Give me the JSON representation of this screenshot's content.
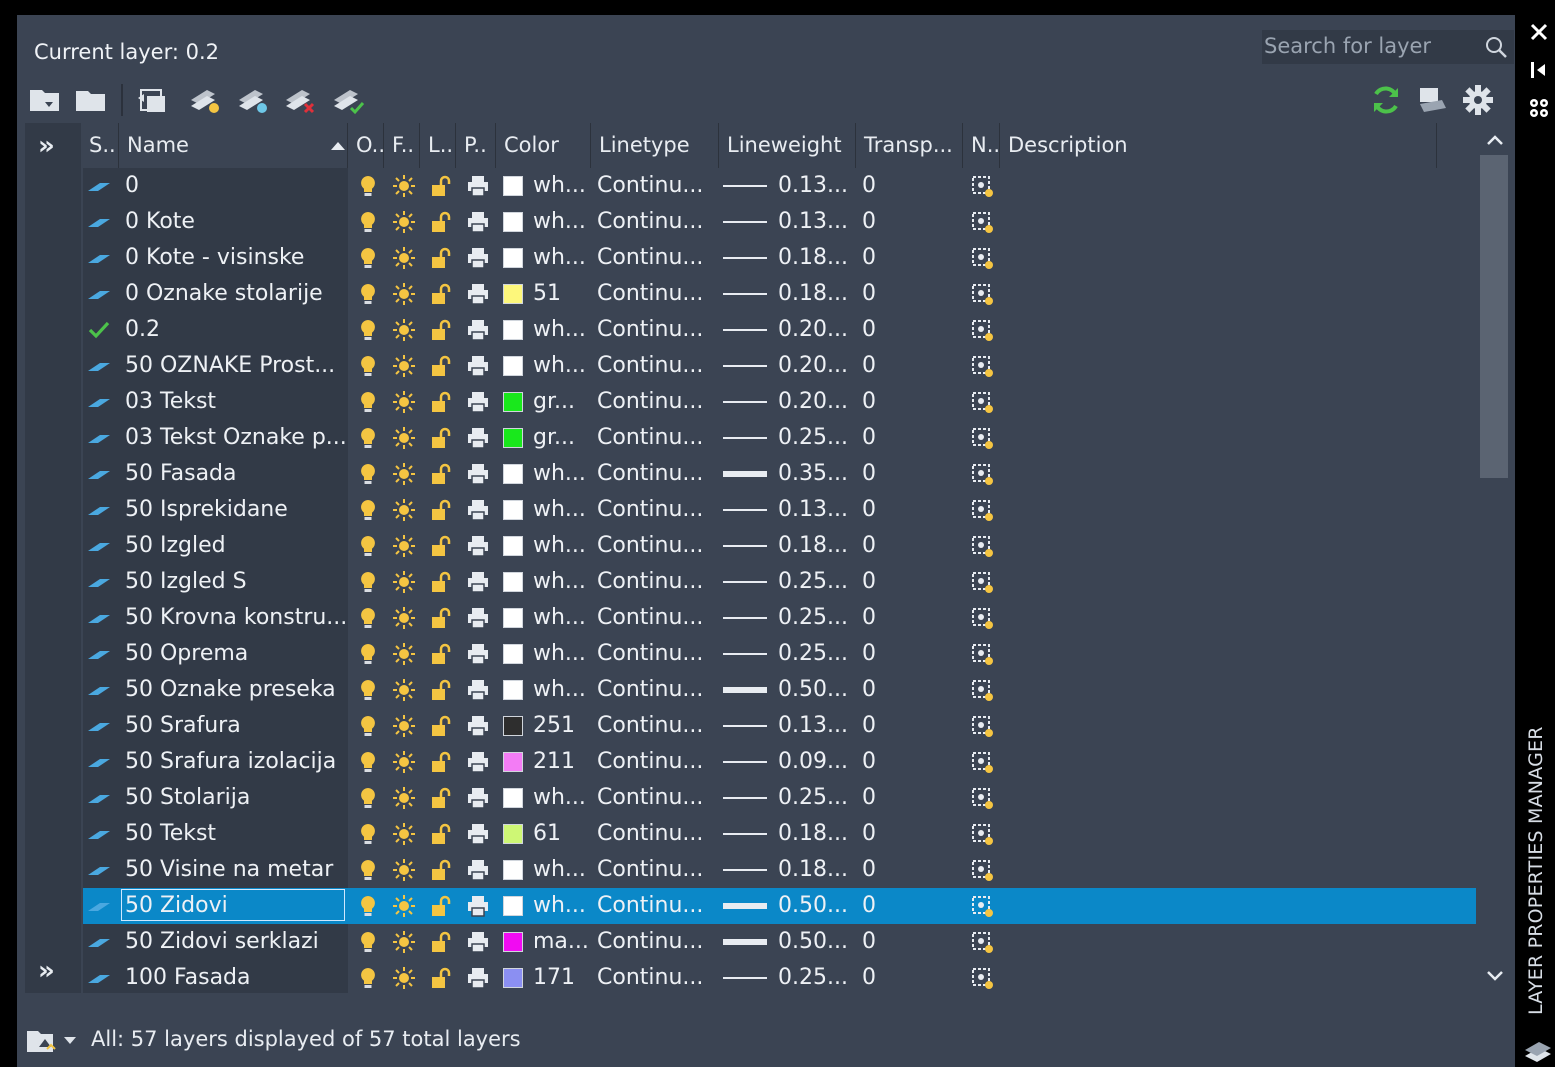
{
  "header": {
    "current_layer_label": "Current layer: 0.2",
    "search_placeholder": "Search for layer"
  },
  "toolbar": {
    "left_buttons": [
      "new-property-filter-icon",
      "new-group-filter-icon",
      "layer-states-manager-icon",
      "new-layer-icon",
      "new-layer-vp-frozen-icon",
      "delete-layer-icon",
      "set-current-icon"
    ],
    "right_buttons": [
      "refresh-icon",
      "layer-settings-icon",
      "gear-icon"
    ]
  },
  "side_panel": {
    "title": "LAYER PROPERTIES MANAGER",
    "expand_label": "»"
  },
  "columns": [
    {
      "key": "status",
      "label": "S.."
    },
    {
      "key": "name",
      "label": "Name"
    },
    {
      "key": "on",
      "label": "O.."
    },
    {
      "key": "freeze",
      "label": "F.."
    },
    {
      "key": "lock",
      "label": "L.."
    },
    {
      "key": "plot",
      "label": "P.."
    },
    {
      "key": "color",
      "label": "Color"
    },
    {
      "key": "linetype",
      "label": "Linetype"
    },
    {
      "key": "lineweight",
      "label": "Lineweight"
    },
    {
      "key": "transparency",
      "label": "Transp..."
    },
    {
      "key": "newvp",
      "label": "N.."
    },
    {
      "key": "description",
      "label": "Description"
    }
  ],
  "colors": {
    "white": "#ffffff",
    "yellow51": "#fdf77b",
    "green": "#19e81c",
    "gray251": "#2e2e2e",
    "pink211": "#f37cf5",
    "lime61": "#cef775",
    "magenta": "#f10bf2",
    "blue171": "#8b8ff2",
    "selection": "#0b88c8",
    "bulb": "#f4c542",
    "sun": "#f5c542"
  },
  "layers": [
    {
      "name": "0",
      "status": "layer",
      "color_label": "wh...",
      "color": "#ffffff",
      "linetype": "Continu...",
      "lineweight": "0.13...",
      "thick": false,
      "transparency": "0"
    },
    {
      "name": "0 Kote",
      "status": "layer",
      "color_label": "wh...",
      "color": "#ffffff",
      "linetype": "Continu...",
      "lineweight": "0.13...",
      "thick": false,
      "transparency": "0"
    },
    {
      "name": "0 Kote - visinske",
      "status": "layer",
      "color_label": "wh...",
      "color": "#ffffff",
      "linetype": "Continu...",
      "lineweight": "0.18...",
      "thick": false,
      "transparency": "0"
    },
    {
      "name": "0 Oznake stolarije",
      "status": "layer",
      "color_label": "51",
      "color": "#fdf77b",
      "linetype": "Continu...",
      "lineweight": "0.18...",
      "thick": false,
      "transparency": "0"
    },
    {
      "name": "0.2",
      "status": "current",
      "color_label": "wh...",
      "color": "#ffffff",
      "linetype": "Continu...",
      "lineweight": "0.20...",
      "thick": false,
      "transparency": "0"
    },
    {
      "name": "50 OZNAKE Prost...",
      "status": "layer",
      "color_label": "wh...",
      "color": "#ffffff",
      "linetype": "Continu...",
      "lineweight": "0.20...",
      "thick": false,
      "transparency": "0"
    },
    {
      "name": "03 Tekst",
      "status": "layer",
      "color_label": "gr...",
      "color": "#19e81c",
      "linetype": "Continu...",
      "lineweight": "0.20...",
      "thick": false,
      "transparency": "0"
    },
    {
      "name": "03 Tekst Oznake p...",
      "status": "layer",
      "color_label": "gr...",
      "color": "#19e81c",
      "linetype": "Continu...",
      "lineweight": "0.25...",
      "thick": false,
      "transparency": "0"
    },
    {
      "name": "50 Fasada",
      "status": "layer",
      "color_label": "wh...",
      "color": "#ffffff",
      "linetype": "Continu...",
      "lineweight": "0.35...",
      "thick": true,
      "transparency": "0"
    },
    {
      "name": "50 Isprekidane",
      "status": "layer",
      "color_label": "wh...",
      "color": "#ffffff",
      "linetype": "Continu...",
      "lineweight": "0.13...",
      "thick": false,
      "transparency": "0"
    },
    {
      "name": "50 Izgled",
      "status": "layer",
      "color_label": "wh...",
      "color": "#ffffff",
      "linetype": "Continu...",
      "lineweight": "0.18...",
      "thick": false,
      "transparency": "0"
    },
    {
      "name": "50 Izgled S",
      "status": "layer",
      "color_label": "wh...",
      "color": "#ffffff",
      "linetype": "Continu...",
      "lineweight": "0.25...",
      "thick": false,
      "transparency": "0"
    },
    {
      "name": "50 Krovna konstru...",
      "status": "layer",
      "color_label": "wh...",
      "color": "#ffffff",
      "linetype": "Continu...",
      "lineweight": "0.25...",
      "thick": false,
      "transparency": "0"
    },
    {
      "name": "50 Oprema",
      "status": "layer",
      "color_label": "wh...",
      "color": "#ffffff",
      "linetype": "Continu...",
      "lineweight": "0.25...",
      "thick": false,
      "transparency": "0"
    },
    {
      "name": "50 Oznake preseka",
      "status": "layer",
      "color_label": "wh...",
      "color": "#ffffff",
      "linetype": "Continu...",
      "lineweight": "0.50...",
      "thick": true,
      "transparency": "0"
    },
    {
      "name": "50 Srafura",
      "status": "layer",
      "color_label": "251",
      "color": "#2e2e2e",
      "linetype": "Continu...",
      "lineweight": "0.13...",
      "thick": false,
      "transparency": "0"
    },
    {
      "name": "50 Srafura izolacija",
      "status": "layer",
      "color_label": "211",
      "color": "#f37cf5",
      "linetype": "Continu...",
      "lineweight": "0.09...",
      "thick": false,
      "transparency": "0"
    },
    {
      "name": "50 Stolarija",
      "status": "layer",
      "color_label": "wh...",
      "color": "#ffffff",
      "linetype": "Continu...",
      "lineweight": "0.25...",
      "thick": false,
      "transparency": "0"
    },
    {
      "name": "50 Tekst",
      "status": "layer",
      "color_label": "61",
      "color": "#cef775",
      "linetype": "Continu...",
      "lineweight": "0.18...",
      "thick": false,
      "transparency": "0"
    },
    {
      "name": "50 Visine na metar",
      "status": "layer",
      "color_label": "wh...",
      "color": "#ffffff",
      "linetype": "Continu...",
      "lineweight": "0.18...",
      "thick": false,
      "transparency": "0"
    },
    {
      "name": "50 Zidovi",
      "status": "layer",
      "selected": true,
      "color_label": "wh...",
      "color": "#ffffff",
      "linetype": "Continu...",
      "lineweight": "0.50...",
      "thick": true,
      "transparency": "0"
    },
    {
      "name": "50 Zidovi serklazi",
      "status": "layer",
      "color_label": "ma...",
      "color": "#f10bf2",
      "linetype": "Continu...",
      "lineweight": "0.50...",
      "thick": true,
      "transparency": "0"
    },
    {
      "name": "100 Fasada",
      "status": "layer",
      "color_label": "171",
      "color": "#8b8ff2",
      "linetype": "Continu...",
      "lineweight": "0.25...",
      "thick": false,
      "transparency": "0"
    }
  ],
  "status": {
    "text": "All: 57 layers displayed of 57 total layers"
  }
}
